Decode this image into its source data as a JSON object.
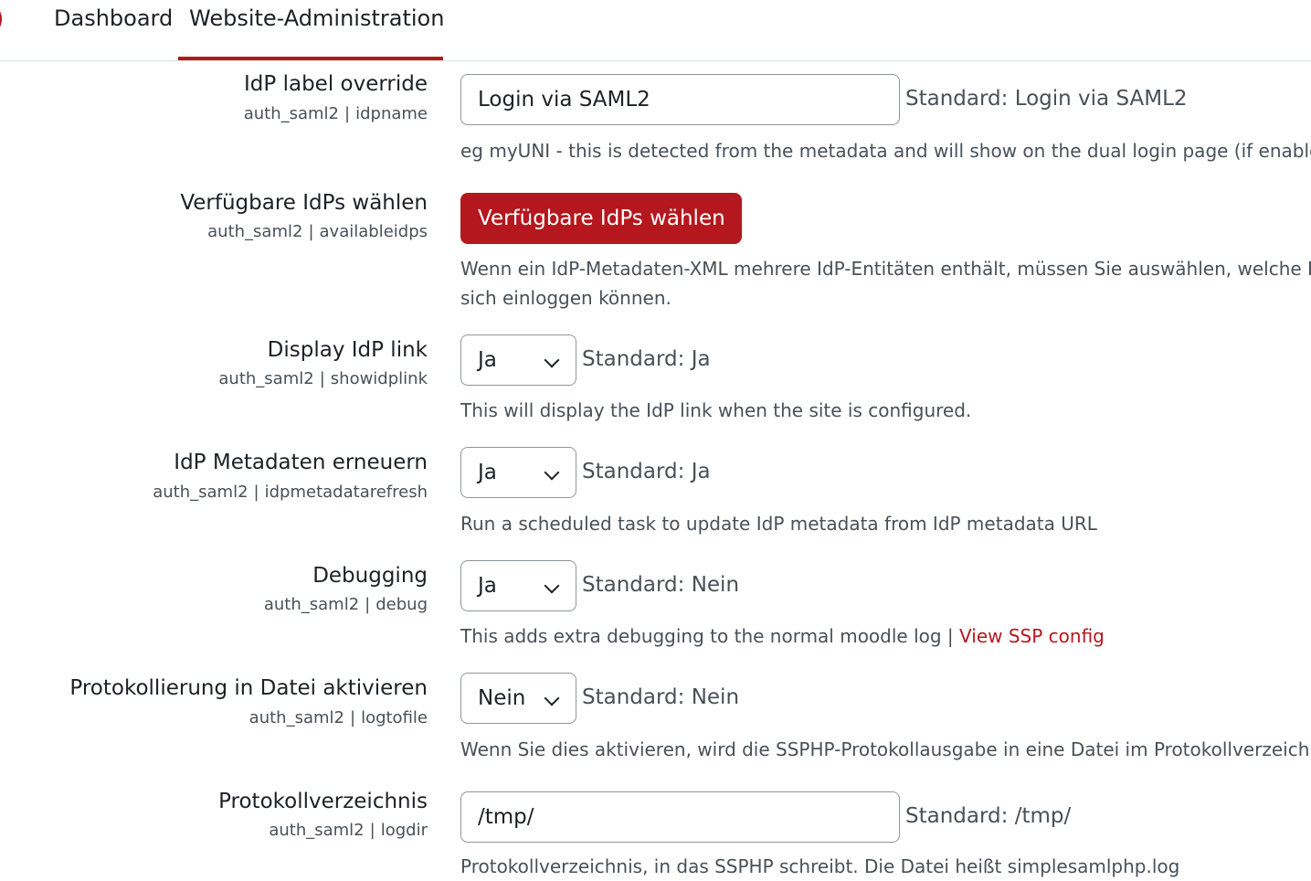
{
  "nav": {
    "tabs": [
      {
        "label": "Dashboard",
        "active": false
      },
      {
        "label": "Website-Administration",
        "active": true
      }
    ]
  },
  "theme": {
    "accent": "#b5171f"
  },
  "settings": {
    "idpname": {
      "label": "IdP label override",
      "key_plugin": "auth_saml2",
      "key_name": "idpname",
      "value": "Login via SAML2",
      "default": "Standard: Login via SAML2",
      "description": "eg myUNI - this is detected from the metadata and will show on the dual login page (if enabled"
    },
    "availableidps": {
      "label": "Verfügbare IdPs wählen",
      "key_plugin": "auth_saml2",
      "key_name": "availableidps",
      "button_label": "Verfügbare IdPs wählen",
      "description_line1": "Wenn ein IdP-Metadaten-XML mehrere IdP-Entitäten enthält, müssen Sie auswählen, welche En",
      "description_line2": "sich einloggen können."
    },
    "showidplink": {
      "label": "Display IdP link",
      "key_plugin": "auth_saml2",
      "key_name": "showidplink",
      "selected": "Ja",
      "default": "Standard: Ja",
      "description": "This will display the IdP link when the site is configured."
    },
    "idpmetadatarefresh": {
      "label": "IdP Metadaten erneuern",
      "key_plugin": "auth_saml2",
      "key_name": "idpmetadatarefresh",
      "selected": "Ja",
      "default": "Standard: Ja",
      "description": "Run a scheduled task to update IdP metadata from IdP metadata URL"
    },
    "debug": {
      "label": "Debugging",
      "key_plugin": "auth_saml2",
      "key_name": "debug",
      "selected": "Ja",
      "default": "Standard: Nein",
      "description": "This adds extra debugging to the normal moodle log | ",
      "link_label": "View SSP config"
    },
    "logtofile": {
      "label": "Protokollierung in Datei aktivieren",
      "key_plugin": "auth_saml2",
      "key_name": "logtofile",
      "selected": "Nein",
      "default": "Standard: Nein",
      "description": "Wenn Sie dies aktivieren, wird die SSPHP-Protokollausgabe in eine Datei im Protokollverzeichni"
    },
    "logdir": {
      "label": "Protokollverzeichnis",
      "key_plugin": "auth_saml2",
      "key_name": "logdir",
      "value": "/tmp/",
      "default": "Standard: /tmp/",
      "description": "Protokollverzeichnis, in das SSPHP schreibt. Die Datei heißt simplesamlphp.log"
    }
  }
}
